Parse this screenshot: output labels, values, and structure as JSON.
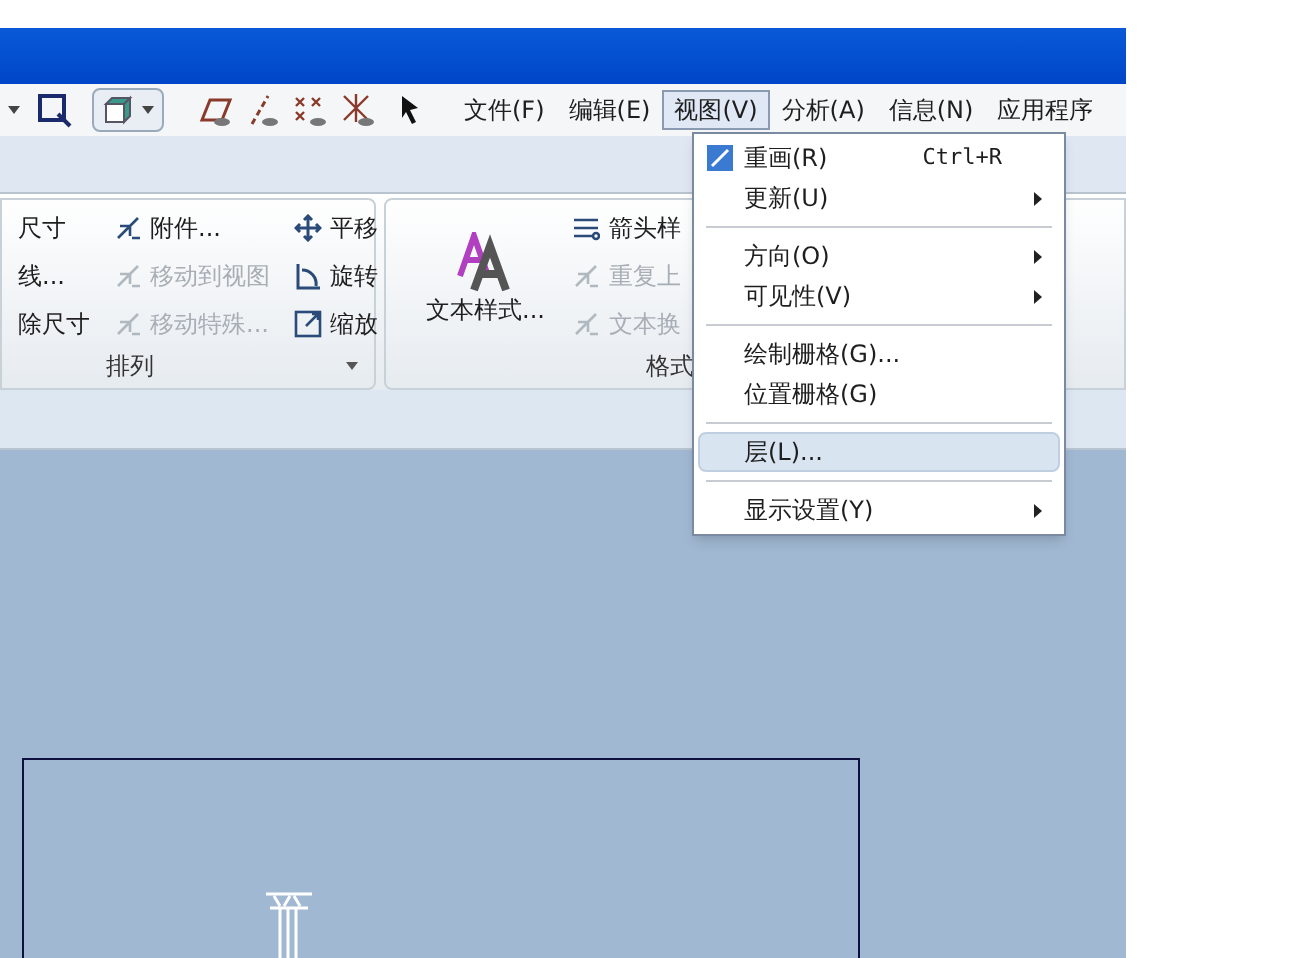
{
  "menubar": [
    {
      "label": "文件(F)",
      "selected": false
    },
    {
      "label": "编辑(E)",
      "selected": false
    },
    {
      "label": "视图(V)",
      "selected": true
    },
    {
      "label": "分析(A)",
      "selected": false
    },
    {
      "label": "信息(N)",
      "selected": false
    },
    {
      "label": "应用程序",
      "selected": false
    }
  ],
  "ribbon": {
    "groups": [
      {
        "label": "排列",
        "columns": [
          [
            {
              "label": "尺寸",
              "disabled": false
            },
            {
              "label": "线...",
              "disabled": false
            },
            {
              "label": "除尺寸",
              "disabled": false
            }
          ],
          [
            {
              "label": "附件...",
              "disabled": false
            },
            {
              "label": "移动到视图",
              "disabled": true
            },
            {
              "label": "移动特殊...",
              "disabled": true
            }
          ],
          [
            {
              "label": "平移",
              "disabled": false
            },
            {
              "label": "旋转",
              "disabled": false
            },
            {
              "label": "缩放",
              "disabled": false
            }
          ]
        ]
      },
      {
        "label": "格式",
        "big_button": "文本样式...",
        "columns": [
          [
            {
              "label": "箭头样",
              "disabled": false
            },
            {
              "label": "重复上",
              "disabled": true
            },
            {
              "label": "文本换",
              "disabled": true
            }
          ]
        ]
      }
    ]
  },
  "view_menu": [
    {
      "kind": "item",
      "label": "重画(R)",
      "shortcut": "Ctrl+R",
      "submenu": false,
      "selected": false
    },
    {
      "kind": "item",
      "label": "更新(U)",
      "submenu": true,
      "selected": false
    },
    {
      "kind": "separator"
    },
    {
      "kind": "item",
      "label": "方向(O)",
      "submenu": true,
      "selected": false
    },
    {
      "kind": "item",
      "label": "可见性(V)",
      "submenu": true,
      "selected": false
    },
    {
      "kind": "separator"
    },
    {
      "kind": "item",
      "label": "绘制栅格(G)...",
      "submenu": false,
      "selected": false
    },
    {
      "kind": "item",
      "label": "位置栅格(G)",
      "submenu": false,
      "selected": false
    },
    {
      "kind": "separator"
    },
    {
      "kind": "item",
      "label": "层(L)...",
      "submenu": false,
      "selected": true
    },
    {
      "kind": "separator"
    },
    {
      "kind": "item",
      "label": "显示设置(Y)",
      "submenu": true,
      "selected": false
    }
  ]
}
